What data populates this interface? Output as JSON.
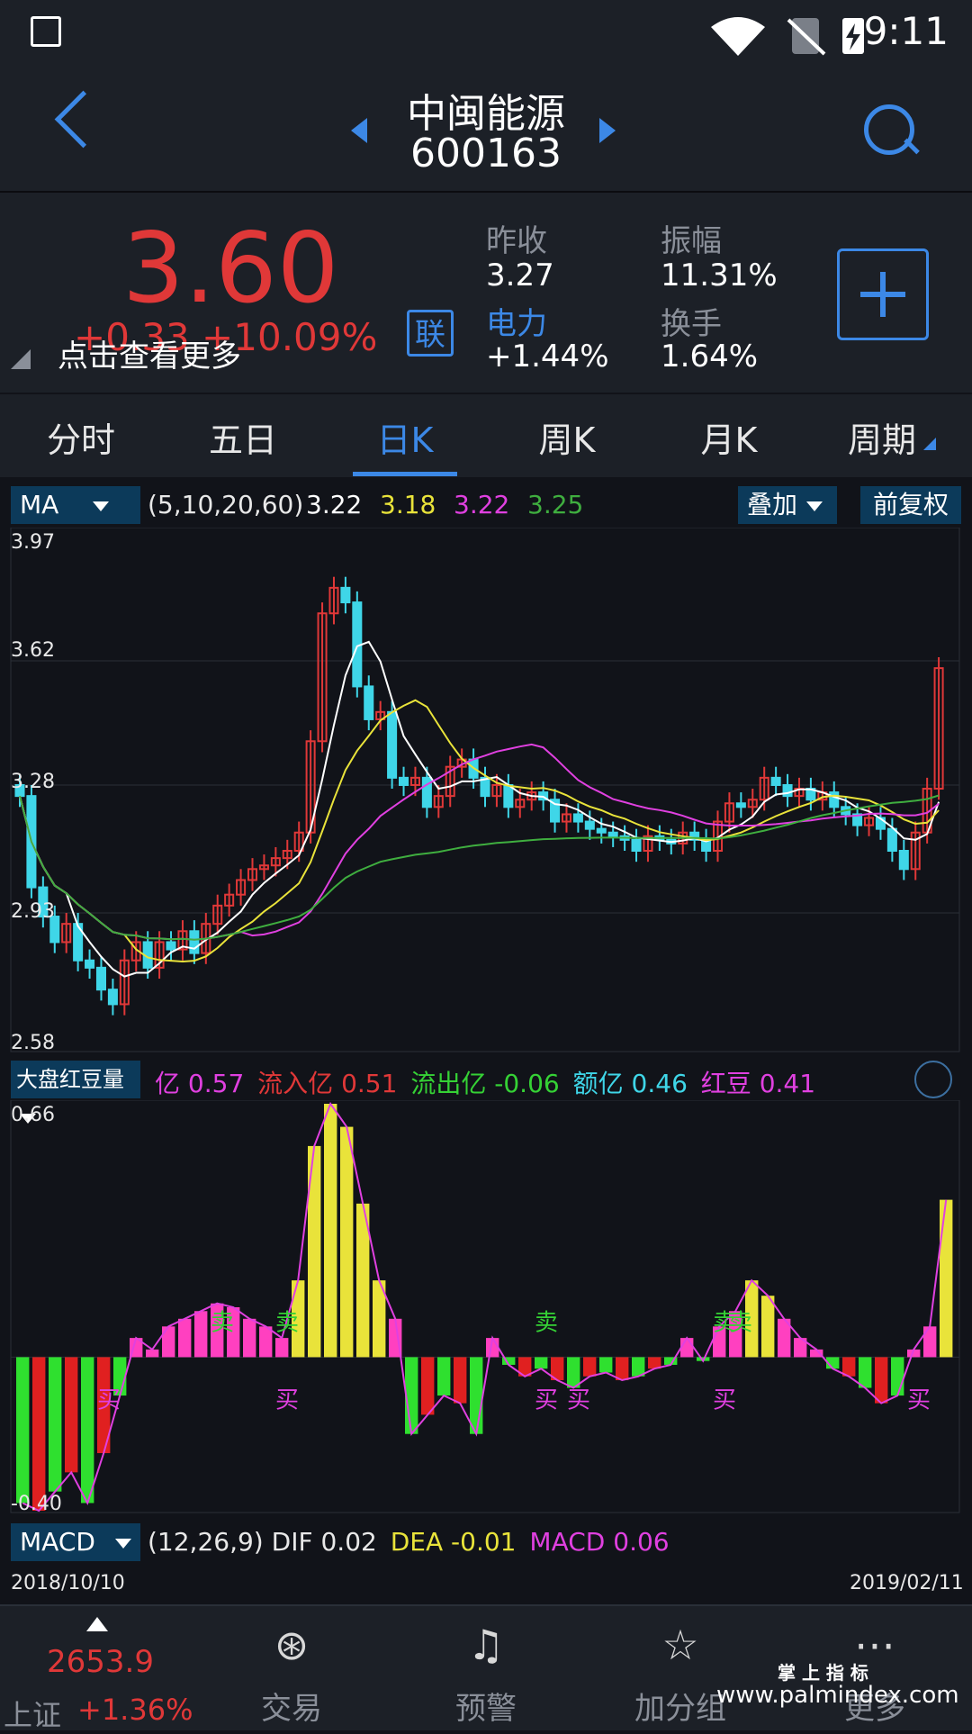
{
  "status": {
    "time": "9:11"
  },
  "stock": {
    "name": "中闽能源",
    "code": "600163"
  },
  "quote": {
    "price": "3.60",
    "change": "+0.33  +10.09%",
    "tip": "点击查看更多",
    "lian": "联",
    "prev_close_label": "昨收",
    "prev_close": "3.27",
    "sector_label": "电力",
    "sector_change": "+1.44%",
    "amplitude_label": "振幅",
    "amplitude": "11.31%",
    "turnover_label": "换手",
    "turnover": "1.64%"
  },
  "tabs": [
    "分时",
    "五日",
    "日K",
    "周K",
    "月K",
    "周期"
  ],
  "active_tab": 2,
  "ma": {
    "name": "MA",
    "params": "(5,10,20,60)",
    "v5": "3.22",
    "v10": "3.18",
    "v20": "3.22",
    "v60": "3.25",
    "overlay": "叠加",
    "adjust": "前复权",
    "colors": {
      "ma5": "#ffffff",
      "ma10": "#e9e33a",
      "ma20": "#e040e0",
      "ma60": "#3fae3f"
    },
    "yticks": [
      "3.97",
      "3.62",
      "3.28",
      "2.93",
      "2.58"
    ]
  },
  "redbean": {
    "name": "大盘红豆量",
    "yi_label": "亿",
    "yi": "0.57",
    "in_label": "流入亿",
    "in": "0.51",
    "out_label": "流出亿",
    "out": "-0.06",
    "amt_label": "额亿",
    "amt": "0.46",
    "bean_label": "红豆",
    "bean": "0.41",
    "ymax": "0.66",
    "ymin": "-0.40",
    "sell": "卖",
    "buy": "买"
  },
  "macd": {
    "name": "MACD",
    "params": "(12,26,9)",
    "dif_label": "DIF",
    "dif": "0.02",
    "dea_label": "DEA",
    "dea": "-0.01",
    "macd_label": "MACD",
    "macd": "0.06"
  },
  "dates": {
    "start": "2018/10/10",
    "end": "2019/02/11"
  },
  "bottom": {
    "index_value": "2653.9",
    "index_name": "上证",
    "index_change": "+1.36%",
    "items": [
      "交易",
      "预警",
      "加分组",
      "更多"
    ]
  },
  "watermark": {
    "cn": "掌 上 指 标",
    "url": "www.palmindex.com"
  },
  "chart_data": {
    "type": "candlestick",
    "ylim": [
      2.58,
      3.97
    ],
    "closes": [
      3.25,
      3.0,
      2.92,
      2.85,
      2.9,
      2.8,
      2.78,
      2.72,
      2.68,
      2.8,
      2.85,
      2.78,
      2.85,
      2.83,
      2.88,
      2.82,
      2.9,
      2.95,
      2.98,
      3.02,
      3.05,
      3.06,
      3.08,
      3.1,
      3.15,
      3.4,
      3.75,
      3.82,
      3.78,
      3.55,
      3.46,
      3.48,
      3.3,
      3.28,
      3.3,
      3.22,
      3.25,
      3.33,
      3.35,
      3.3,
      3.25,
      3.28,
      3.22,
      3.24,
      3.26,
      3.24,
      3.18,
      3.2,
      3.18,
      3.16,
      3.15,
      3.14,
      3.13,
      3.1,
      3.14,
      3.13,
      3.12,
      3.15,
      3.13,
      3.1,
      3.18,
      3.23,
      3.22,
      3.24,
      3.3,
      3.28,
      3.25,
      3.27,
      3.24,
      3.26,
      3.22,
      3.2,
      3.17,
      3.19,
      3.16,
      3.1,
      3.05,
      3.15,
      3.27,
      3.6
    ],
    "volume": [
      -0.38,
      -0.4,
      -0.35,
      -0.3,
      -0.38,
      -0.25,
      -0.1,
      0.05,
      0.02,
      0.08,
      0.1,
      0.12,
      0.14,
      0.13,
      0.1,
      0.08,
      0.05,
      0.2,
      0.55,
      0.66,
      0.6,
      0.4,
      0.2,
      0.1,
      -0.2,
      -0.15,
      -0.1,
      -0.12,
      -0.2,
      0.05,
      -0.02,
      -0.05,
      -0.03,
      -0.06,
      -0.08,
      -0.05,
      -0.04,
      -0.06,
      -0.05,
      -0.03,
      -0.02,
      0.05,
      -0.01,
      0.08,
      0.12,
      0.2,
      0.16,
      0.1,
      0.05,
      0.02,
      -0.03,
      -0.05,
      -0.08,
      -0.12,
      -0.1,
      0.02,
      0.08,
      0.41
    ]
  }
}
